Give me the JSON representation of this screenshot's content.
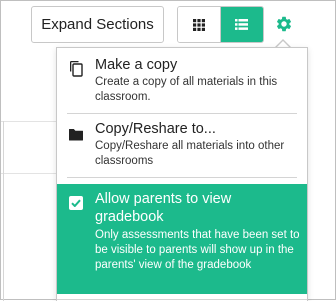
{
  "toolbar": {
    "expand_label": "Expand Sections"
  },
  "colors": {
    "accent": "#1cba8c",
    "border": "#c8c8c8"
  },
  "icons": {
    "grid_view": "grid-icon",
    "list_view": "list-icon",
    "settings": "gear-icon",
    "copy": "copy-icon",
    "reshare": "folder-icon",
    "checkbox": "checkbox-checked-icon"
  },
  "menu": {
    "items": [
      {
        "title": "Make a copy",
        "description": "Create a copy of all materials in this classroom."
      },
      {
        "title": "Copy/Reshare to...",
        "description": "Copy/Reshare all materials into other classrooms"
      },
      {
        "title": "Allow parents to view gradebook",
        "description": "Only assessments that have been set to be visible to parents will show up in the parents' view of the gradebook",
        "checked": true
      }
    ]
  }
}
